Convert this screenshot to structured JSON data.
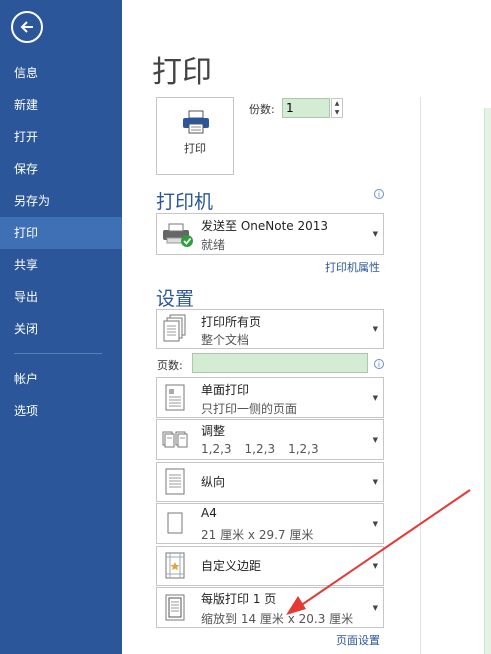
{
  "nav": {
    "items": [
      "信息",
      "新建",
      "打开",
      "保存",
      "另存为",
      "打印",
      "共享",
      "导出",
      "关闭"
    ],
    "bottom": [
      "帐户",
      "选项"
    ]
  },
  "title": "打印",
  "print_button": "打印",
  "copies": {
    "label": "份数:",
    "value": "1"
  },
  "printer": {
    "heading": "打印机",
    "name": "发送至 OneNote 2013",
    "status": "就绪",
    "properties_link": "打印机属性"
  },
  "settings": {
    "heading": "设置",
    "pages_label": "页数:",
    "pages_value": "",
    "items": [
      {
        "l1": "打印所有页",
        "l2": "整个文档"
      },
      {
        "l1": "单面打印",
        "l2": "只打印一侧的页面"
      },
      {
        "l1": "调整",
        "l2parts": [
          "1,2,3",
          "1,2,3",
          "1,2,3"
        ]
      },
      {
        "l1": "纵向"
      },
      {
        "l1": "A4",
        "l2": "21 厘米 x 29.7 厘米"
      },
      {
        "l1": "自定义边距"
      },
      {
        "l1": "每版打印 1 页",
        "l2": "缩放到 14 厘米 x 20.3 厘米"
      }
    ],
    "page_setup_link": "页面设置"
  },
  "colors": {
    "sidebar": "#2b579a",
    "accent": "#2b579a",
    "annotation_arrow": "#e53935",
    "input_fill": "#d3ecd3"
  },
  "icons": [
    "back-arrow-icon",
    "printer-icon",
    "info-icon",
    "onenote-printer-icon",
    "pages-icon",
    "single-side-icon",
    "collate-icon",
    "portrait-icon",
    "paper-size-icon",
    "margins-icon",
    "pages-per-sheet-icon",
    "chevron-down-icon"
  ]
}
